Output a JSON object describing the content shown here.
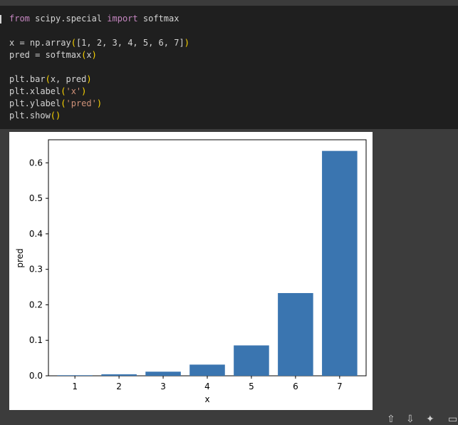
{
  "code": {
    "lines": [
      [
        {
          "t": "from",
          "c": "kw"
        },
        {
          "t": " scipy.special "
        },
        {
          "t": "import",
          "c": "kw"
        },
        {
          "t": " softmax"
        }
      ],
      [],
      [
        {
          "t": "x = np.array"
        },
        {
          "t": "(",
          "c": "pn"
        },
        {
          "t": "["
        },
        {
          "t": "1, 2, 3, 4, 5, 6, 7"
        },
        {
          "t": "]"
        },
        {
          "t": ")",
          "c": "pn"
        }
      ],
      [
        {
          "t": "pred = softmax"
        },
        {
          "t": "(",
          "c": "pn"
        },
        {
          "t": "x"
        },
        {
          "t": ")",
          "c": "pn"
        }
      ],
      [],
      [
        {
          "t": "plt.bar"
        },
        {
          "t": "(",
          "c": "pn"
        },
        {
          "t": "x, pred"
        },
        {
          "t": ")",
          "c": "pn"
        }
      ],
      [
        {
          "t": "plt.xlabel"
        },
        {
          "t": "(",
          "c": "pn"
        },
        {
          "t": "'x'",
          "c": "str"
        },
        {
          "t": ")",
          "c": "pn"
        }
      ],
      [
        {
          "t": "plt.ylabel"
        },
        {
          "t": "(",
          "c": "pn"
        },
        {
          "t": "'pred'",
          "c": "str"
        },
        {
          "t": ")",
          "c": "pn"
        }
      ],
      [
        {
          "t": "plt.show"
        },
        {
          "t": "()",
          "c": "pn"
        }
      ]
    ]
  },
  "chart_data": {
    "type": "bar",
    "categories": [
      "1",
      "2",
      "3",
      "4",
      "5",
      "6",
      "7"
    ],
    "values": [
      0.0016,
      0.0043,
      0.0116,
      0.0315,
      0.0856,
      0.2331,
      0.6336
    ],
    "xlabel": "x",
    "ylabel": "pred",
    "ylim": [
      0,
      0.665
    ],
    "yticks": [
      0.0,
      0.1,
      0.2,
      0.3,
      0.4,
      0.5,
      0.6
    ],
    "ytick_labels": [
      "0.0",
      "0.1",
      "0.2",
      "0.3",
      "0.4",
      "0.5",
      "0.6"
    ],
    "bar_color": "#3a75b0",
    "grid": false
  },
  "colors": {
    "editor_bg": "#1f1f1f",
    "keyword": "#c586c0",
    "string": "#ce9178",
    "paren": "#ffd700"
  }
}
